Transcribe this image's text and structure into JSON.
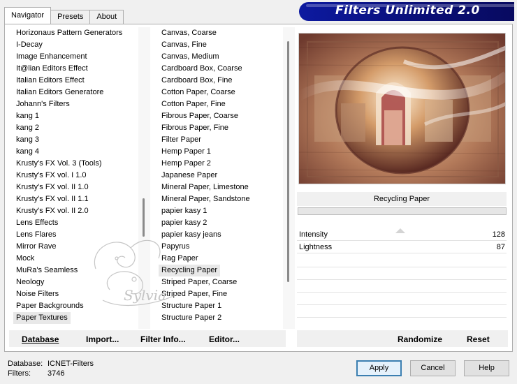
{
  "tabs": [
    "Navigator",
    "Presets",
    "About"
  ],
  "banner_title": "Filters Unlimited 2.0",
  "categories": [
    "Horizonaus Pattern Generators",
    "I-Decay",
    "Image Enhancement",
    "It@lian Editors Effect",
    "Italian Editors Effect",
    "Italian Editors Generatore",
    "Johann's Filters",
    "kang 1",
    "kang 2",
    "kang 3",
    "kang 4",
    "Krusty's FX Vol. 3 (Tools)",
    "Krusty's FX vol. I 1.0",
    "Krusty's FX vol. II 1.0",
    "Krusty's FX vol. II 1.1",
    "Krusty's FX vol. II 2.0",
    "Lens Effects",
    "Lens Flares",
    "Mirror Rave",
    "Mock",
    "MuRa's Seamless",
    "Neology",
    "Noise Filters",
    "Paper Backgrounds",
    "Paper Textures"
  ],
  "selected_category": "Paper Textures",
  "filters": [
    "Canvas, Coarse",
    "Canvas, Fine",
    "Canvas, Medium",
    "Cardboard Box, Coarse",
    "Cardboard Box, Fine",
    "Cotton Paper, Coarse",
    "Cotton Paper, Fine",
    "Fibrous Paper, Coarse",
    "Fibrous Paper, Fine",
    "Filter Paper",
    "Hemp Paper 1",
    "Hemp Paper 2",
    "Japanese Paper",
    "Mineral Paper, Limestone",
    "Mineral Paper, Sandstone",
    "papier kasy 1",
    "papier kasy 2",
    "papier kasy jeans",
    "Papyrus",
    "Rag Paper",
    "Recycling Paper",
    "Striped Paper, Coarse",
    "Striped Paper, Fine",
    "Structure Paper 1",
    "Structure Paper 2"
  ],
  "selected_filter": "Recycling Paper",
  "current_filter_name": "Recycling Paper",
  "watermark_text": "Sylvia",
  "sliders": [
    {
      "label": "Intensity",
      "value": "128",
      "level": 128
    },
    {
      "label": "Lightness",
      "value": "87",
      "level": 87
    }
  ],
  "bottom_left": {
    "database": "Database",
    "import": "Import...",
    "filter_info": "Filter Info...",
    "editor": "Editor..."
  },
  "bottom_right": {
    "randomize": "Randomize",
    "reset": "Reset"
  },
  "status": {
    "database_label": "Database:",
    "database_value": "ICNET-Filters",
    "filters_label": "Filters:",
    "filters_value": "3746"
  },
  "buttons": {
    "apply": "Apply",
    "cancel": "Cancel",
    "help": "Help"
  }
}
